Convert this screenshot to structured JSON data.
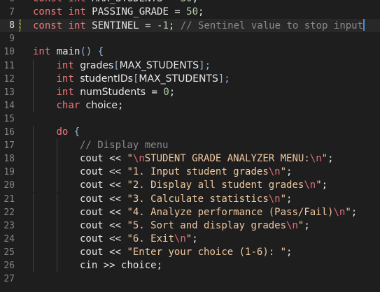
{
  "editor": {
    "lines": [
      {
        "num": "6",
        "tokens": [
          {
            "t": "const ",
            "c": "kw"
          },
          {
            "t": "int ",
            "c": "kw"
          },
          {
            "t": "MAX_STUDENTS",
            "c": "id"
          },
          {
            "t": " = ",
            "c": "op"
          },
          {
            "t": "30",
            "c": "num"
          },
          {
            "t": ";",
            "c": "pun"
          }
        ]
      },
      {
        "num": "7",
        "tokens": [
          {
            "t": "const ",
            "c": "kw"
          },
          {
            "t": "int ",
            "c": "kw"
          },
          {
            "t": "PASSING_GRADE",
            "c": "id"
          },
          {
            "t": " = ",
            "c": "op"
          },
          {
            "t": "50",
            "c": "num"
          },
          {
            "t": ";",
            "c": "pun"
          }
        ]
      },
      {
        "num": "8",
        "active": true,
        "modified": true,
        "cursor": true,
        "tokens": [
          {
            "t": "const ",
            "c": "kw"
          },
          {
            "t": "int ",
            "c": "kw"
          },
          {
            "t": "SENTINEL",
            "c": "id"
          },
          {
            "t": " = ",
            "c": "op"
          },
          {
            "t": "-1",
            "c": "num"
          },
          {
            "t": "; ",
            "c": "pun"
          },
          {
            "t": "// Sentinel value to stop input",
            "c": "com"
          }
        ]
      },
      {
        "num": "9",
        "tokens": []
      },
      {
        "num": "10",
        "tokens": [
          {
            "t": "int ",
            "c": "kw"
          },
          {
            "t": "main",
            "c": "fn"
          },
          {
            "t": "() {",
            "c": "br"
          }
        ]
      },
      {
        "num": "11",
        "indent": 1,
        "tokens": [
          {
            "t": "int ",
            "c": "kw"
          },
          {
            "t": "grades",
            "c": "id sans"
          },
          {
            "t": "[",
            "c": "br"
          },
          {
            "t": "MAX_STUDENTS",
            "c": "id sans"
          },
          {
            "t": "];",
            "c": "br"
          }
        ]
      },
      {
        "num": "12",
        "indent": 1,
        "tokens": [
          {
            "t": "int ",
            "c": "kw"
          },
          {
            "t": "studentIDs",
            "c": "id sans"
          },
          {
            "t": "[",
            "c": "br"
          },
          {
            "t": "MAX_STUDENTS",
            "c": "id sans"
          },
          {
            "t": "];",
            "c": "br"
          }
        ]
      },
      {
        "num": "13",
        "indent": 1,
        "tokens": [
          {
            "t": "int ",
            "c": "kw"
          },
          {
            "t": "numStudents",
            "c": "id sans"
          },
          {
            "t": " = ",
            "c": "op"
          },
          {
            "t": "0",
            "c": "num"
          },
          {
            "t": ";",
            "c": "pun"
          }
        ]
      },
      {
        "num": "14",
        "indent": 1,
        "tokens": [
          {
            "t": "char ",
            "c": "kw"
          },
          {
            "t": "choice",
            "c": "id sans"
          },
          {
            "t": ";",
            "c": "pun"
          }
        ]
      },
      {
        "num": "15",
        "tokens": []
      },
      {
        "num": "16",
        "indent": 1,
        "tokens": [
          {
            "t": "do ",
            "c": "kw"
          },
          {
            "t": "{",
            "c": "br"
          }
        ]
      },
      {
        "num": "17",
        "indent": 2,
        "tokens": [
          {
            "t": "// Display menu",
            "c": "com"
          }
        ]
      },
      {
        "num": "18",
        "indent": 2,
        "tokens": [
          {
            "t": "cout ",
            "c": "id"
          },
          {
            "t": "<< ",
            "c": "op"
          },
          {
            "t": "\"",
            "c": "str"
          },
          {
            "t": "\\n",
            "c": "esc"
          },
          {
            "t": "STUDENT GRADE ANALYZER MENU:",
            "c": "str"
          },
          {
            "t": "\\n",
            "c": "esc"
          },
          {
            "t": "\"",
            "c": "str"
          },
          {
            "t": ";",
            "c": "pun"
          }
        ]
      },
      {
        "num": "19",
        "indent": 2,
        "tokens": [
          {
            "t": "cout ",
            "c": "id"
          },
          {
            "t": "<< ",
            "c": "op"
          },
          {
            "t": "\"1. Input student grades",
            "c": "str"
          },
          {
            "t": "\\n",
            "c": "esc"
          },
          {
            "t": "\"",
            "c": "str"
          },
          {
            "t": ";",
            "c": "pun"
          }
        ]
      },
      {
        "num": "20",
        "indent": 2,
        "tokens": [
          {
            "t": "cout ",
            "c": "id"
          },
          {
            "t": "<< ",
            "c": "op"
          },
          {
            "t": "\"2. Display all student grades",
            "c": "str"
          },
          {
            "t": "\\n",
            "c": "esc"
          },
          {
            "t": "\"",
            "c": "str"
          },
          {
            "t": ";",
            "c": "pun"
          }
        ]
      },
      {
        "num": "21",
        "indent": 2,
        "tokens": [
          {
            "t": "cout ",
            "c": "id"
          },
          {
            "t": "<< ",
            "c": "op"
          },
          {
            "t": "\"3. Calculate statistics",
            "c": "str"
          },
          {
            "t": "\\n",
            "c": "esc"
          },
          {
            "t": "\"",
            "c": "str"
          },
          {
            "t": ";",
            "c": "pun"
          }
        ]
      },
      {
        "num": "22",
        "indent": 2,
        "tokens": [
          {
            "t": "cout ",
            "c": "id"
          },
          {
            "t": "<< ",
            "c": "op"
          },
          {
            "t": "\"4. Analyze performance (Pass/Fail)",
            "c": "str"
          },
          {
            "t": "\\n",
            "c": "esc"
          },
          {
            "t": "\"",
            "c": "str"
          },
          {
            "t": ";",
            "c": "pun"
          }
        ]
      },
      {
        "num": "23",
        "indent": 2,
        "tokens": [
          {
            "t": "cout ",
            "c": "id"
          },
          {
            "t": "<< ",
            "c": "op"
          },
          {
            "t": "\"5. Sort and display grades",
            "c": "str"
          },
          {
            "t": "\\n",
            "c": "esc"
          },
          {
            "t": "\"",
            "c": "str"
          },
          {
            "t": ";",
            "c": "pun"
          }
        ]
      },
      {
        "num": "24",
        "indent": 2,
        "tokens": [
          {
            "t": "cout ",
            "c": "id"
          },
          {
            "t": "<< ",
            "c": "op"
          },
          {
            "t": "\"6. Exit",
            "c": "str"
          },
          {
            "t": "\\n",
            "c": "esc"
          },
          {
            "t": "\"",
            "c": "str"
          },
          {
            "t": ";",
            "c": "pun"
          }
        ]
      },
      {
        "num": "25",
        "indent": 2,
        "tokens": [
          {
            "t": "cout ",
            "c": "id"
          },
          {
            "t": "<< ",
            "c": "op"
          },
          {
            "t": "\"Enter your choice (1-6): \"",
            "c": "str"
          },
          {
            "t": ";",
            "c": "pun"
          }
        ]
      },
      {
        "num": "26",
        "indent": 2,
        "tokens": [
          {
            "t": "cin ",
            "c": "id"
          },
          {
            "t": ">> ",
            "c": "op"
          },
          {
            "t": "choice",
            "c": "id"
          },
          {
            "t": ";",
            "c": "pun"
          }
        ]
      },
      {
        "num": "27",
        "tokens": []
      }
    ]
  }
}
